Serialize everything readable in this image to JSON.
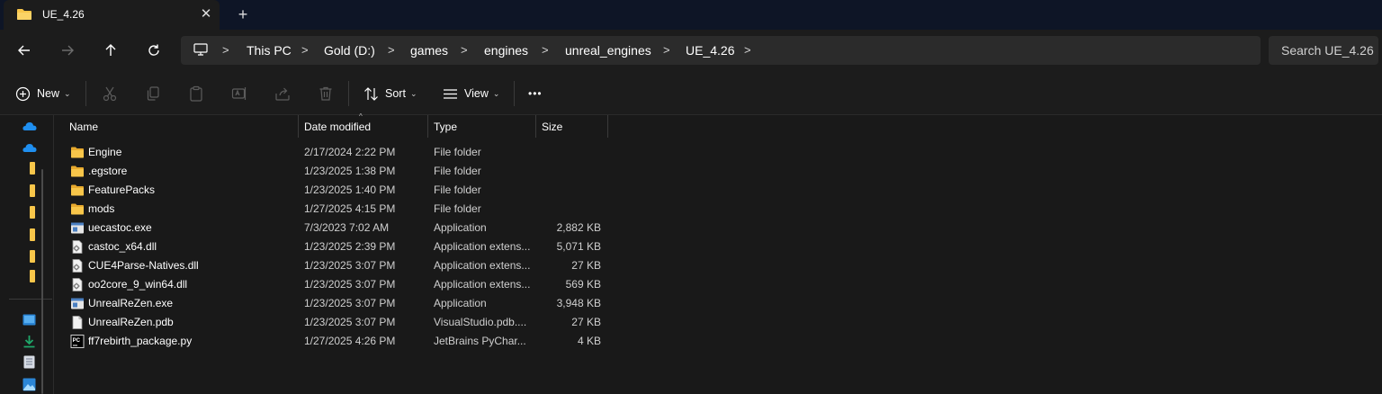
{
  "tab": {
    "title": "UE_4.26",
    "close_glyph": "✕",
    "new_tab_glyph": "+"
  },
  "nav": {
    "back_icon": "arrow-left-icon",
    "forward_icon": "arrow-right-icon",
    "up_icon": "arrow-up-icon",
    "refresh_icon": "refresh-icon"
  },
  "breadcrumb": {
    "items": [
      "This PC",
      "Gold (D:)",
      "games",
      "engines",
      "unreal_engines",
      "UE_4.26"
    ],
    "separator": ">"
  },
  "search": {
    "placeholder": "Search UE_4.26"
  },
  "commands": {
    "new_label": "New",
    "sort_label": "Sort",
    "view_label": "View",
    "more_label": "•••",
    "icons": [
      "cut-icon",
      "copy-icon",
      "paste-icon",
      "rename-icon",
      "share-icon",
      "delete-icon"
    ]
  },
  "columns": {
    "name": "Name",
    "date": "Date modified",
    "type": "Type",
    "size": "Size",
    "sort_indicator": "^"
  },
  "files": [
    {
      "name": "Engine",
      "date": "2/17/2024 2:22 PM",
      "type": "File folder",
      "size": "",
      "icon": "folder-icon"
    },
    {
      "name": ".egstore",
      "date": "1/23/2025 1:38 PM",
      "type": "File folder",
      "size": "",
      "icon": "folder-icon"
    },
    {
      "name": "FeaturePacks",
      "date": "1/23/2025 1:40 PM",
      "type": "File folder",
      "size": "",
      "icon": "folder-icon"
    },
    {
      "name": "mods",
      "date": "1/27/2025 4:15 PM",
      "type": "File folder",
      "size": "",
      "icon": "folder-icon"
    },
    {
      "name": "uecastoc.exe",
      "date": "7/3/2023 7:02 AM",
      "type": "Application",
      "size": "2,882 KB",
      "icon": "exe-icon"
    },
    {
      "name": "castoc_x64.dll",
      "date": "1/23/2025 2:39 PM",
      "type": "Application extens...",
      "size": "5,071 KB",
      "icon": "dll-icon"
    },
    {
      "name": "CUE4Parse-Natives.dll",
      "date": "1/23/2025 3:07 PM",
      "type": "Application extens...",
      "size": "27 KB",
      "icon": "dll-icon"
    },
    {
      "name": "oo2core_9_win64.dll",
      "date": "1/23/2025 3:07 PM",
      "type": "Application extens...",
      "size": "569 KB",
      "icon": "dll-icon"
    },
    {
      "name": "UnrealReZen.exe",
      "date": "1/23/2025 3:07 PM",
      "type": "Application",
      "size": "3,948 KB",
      "icon": "exe-icon"
    },
    {
      "name": "UnrealReZen.pdb",
      "date": "1/23/2025 3:07 PM",
      "type": "VisualStudio.pdb....",
      "size": "27 KB",
      "icon": "file-icon"
    },
    {
      "name": "ff7rebirth_package.py",
      "date": "1/27/2025 4:26 PM",
      "type": "JetBrains PyChar...",
      "size": "4 KB",
      "icon": "pycharm-icon"
    }
  ],
  "colors": {
    "tabbar_bg": "#0e1526",
    "toolbar_bg": "#1c1c1c",
    "list_bg": "#191919",
    "folder": "#f8c64a",
    "onedrive": "#1f8ff0",
    "download": "#1fa86a"
  }
}
